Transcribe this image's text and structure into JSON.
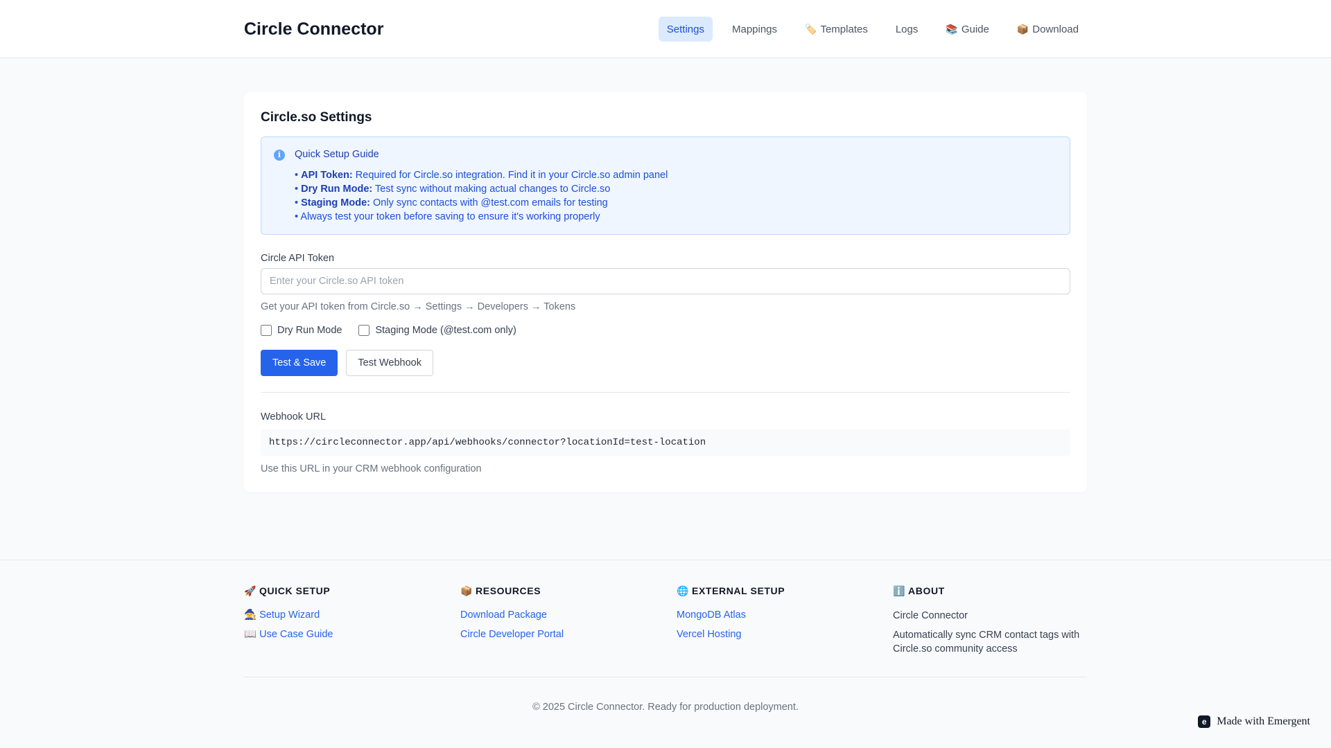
{
  "header": {
    "brand": "Circle Connector",
    "nav": [
      {
        "emoji": "",
        "label": "Settings",
        "active": true
      },
      {
        "emoji": "",
        "label": "Mappings"
      },
      {
        "emoji": "🏷️",
        "label": "Templates"
      },
      {
        "emoji": "",
        "label": "Logs"
      },
      {
        "emoji": "📚",
        "label": "Guide"
      },
      {
        "emoji": "📦",
        "label": "Download"
      }
    ]
  },
  "settings": {
    "title": "Circle.so Settings",
    "guide": {
      "title": "Quick Setup Guide",
      "items": [
        {
          "bold": "API Token:",
          "text": "Required for Circle.so integration. Find it in your Circle.so admin panel"
        },
        {
          "bold": "Dry Run Mode:",
          "text": "Test sync without making actual changes to Circle.so"
        },
        {
          "bold": "Staging Mode:",
          "text": "Only sync contacts with @test.com emails for testing"
        },
        {
          "bold": "",
          "text": "Always test your token before saving to ensure it's working properly"
        }
      ]
    },
    "token_label": "Circle API Token",
    "token_value": "",
    "token_placeholder": "Enter your Circle.so API token",
    "token_help": "Get your API token from Circle.so → Settings → Developers → Tokens",
    "dry_run_label": "Dry Run Mode",
    "dry_run_checked": false,
    "staging_label": "Staging Mode (@test.com only)",
    "staging_checked": false,
    "test_save_label": "Test & Save",
    "test_webhook_label": "Test Webhook",
    "webhook_label": "Webhook URL",
    "webhook_url": "https://circleconnector.app/api/webhooks/connector?locationId=test-location",
    "webhook_help": "Use this URL in your CRM webhook configuration"
  },
  "footer": {
    "quick_setup": {
      "emoji": "🚀",
      "title": "QUICK SETUP",
      "links": [
        {
          "emoji": "🧙",
          "label": "Setup Wizard"
        },
        {
          "emoji": "📖",
          "label": "Use Case Guide"
        }
      ]
    },
    "resources": {
      "emoji": "📦",
      "title": "RESOURCES",
      "links": [
        {
          "label": "Download Package"
        },
        {
          "label": "Circle Developer Portal"
        }
      ]
    },
    "external_setup": {
      "emoji": "🌐",
      "title": "EXTERNAL SETUP",
      "links": [
        {
          "label": "MongoDB Atlas"
        },
        {
          "label": "Vercel Hosting"
        }
      ]
    },
    "about": {
      "emoji": "ℹ️",
      "title": "ABOUT",
      "name": "Circle Connector",
      "description": "Automatically sync CRM contact tags with Circle.so community access"
    },
    "copyright": "© 2025 Circle Connector. Ready for production deployment."
  },
  "badge": {
    "icon_letter": "e",
    "label": "Made with Emergent"
  },
  "colors": {
    "primary": "#2563eb",
    "guide_bg": "#eff6ff",
    "guide_border": "#bfdbfe",
    "active_nav_bg": "#dbeafe"
  }
}
